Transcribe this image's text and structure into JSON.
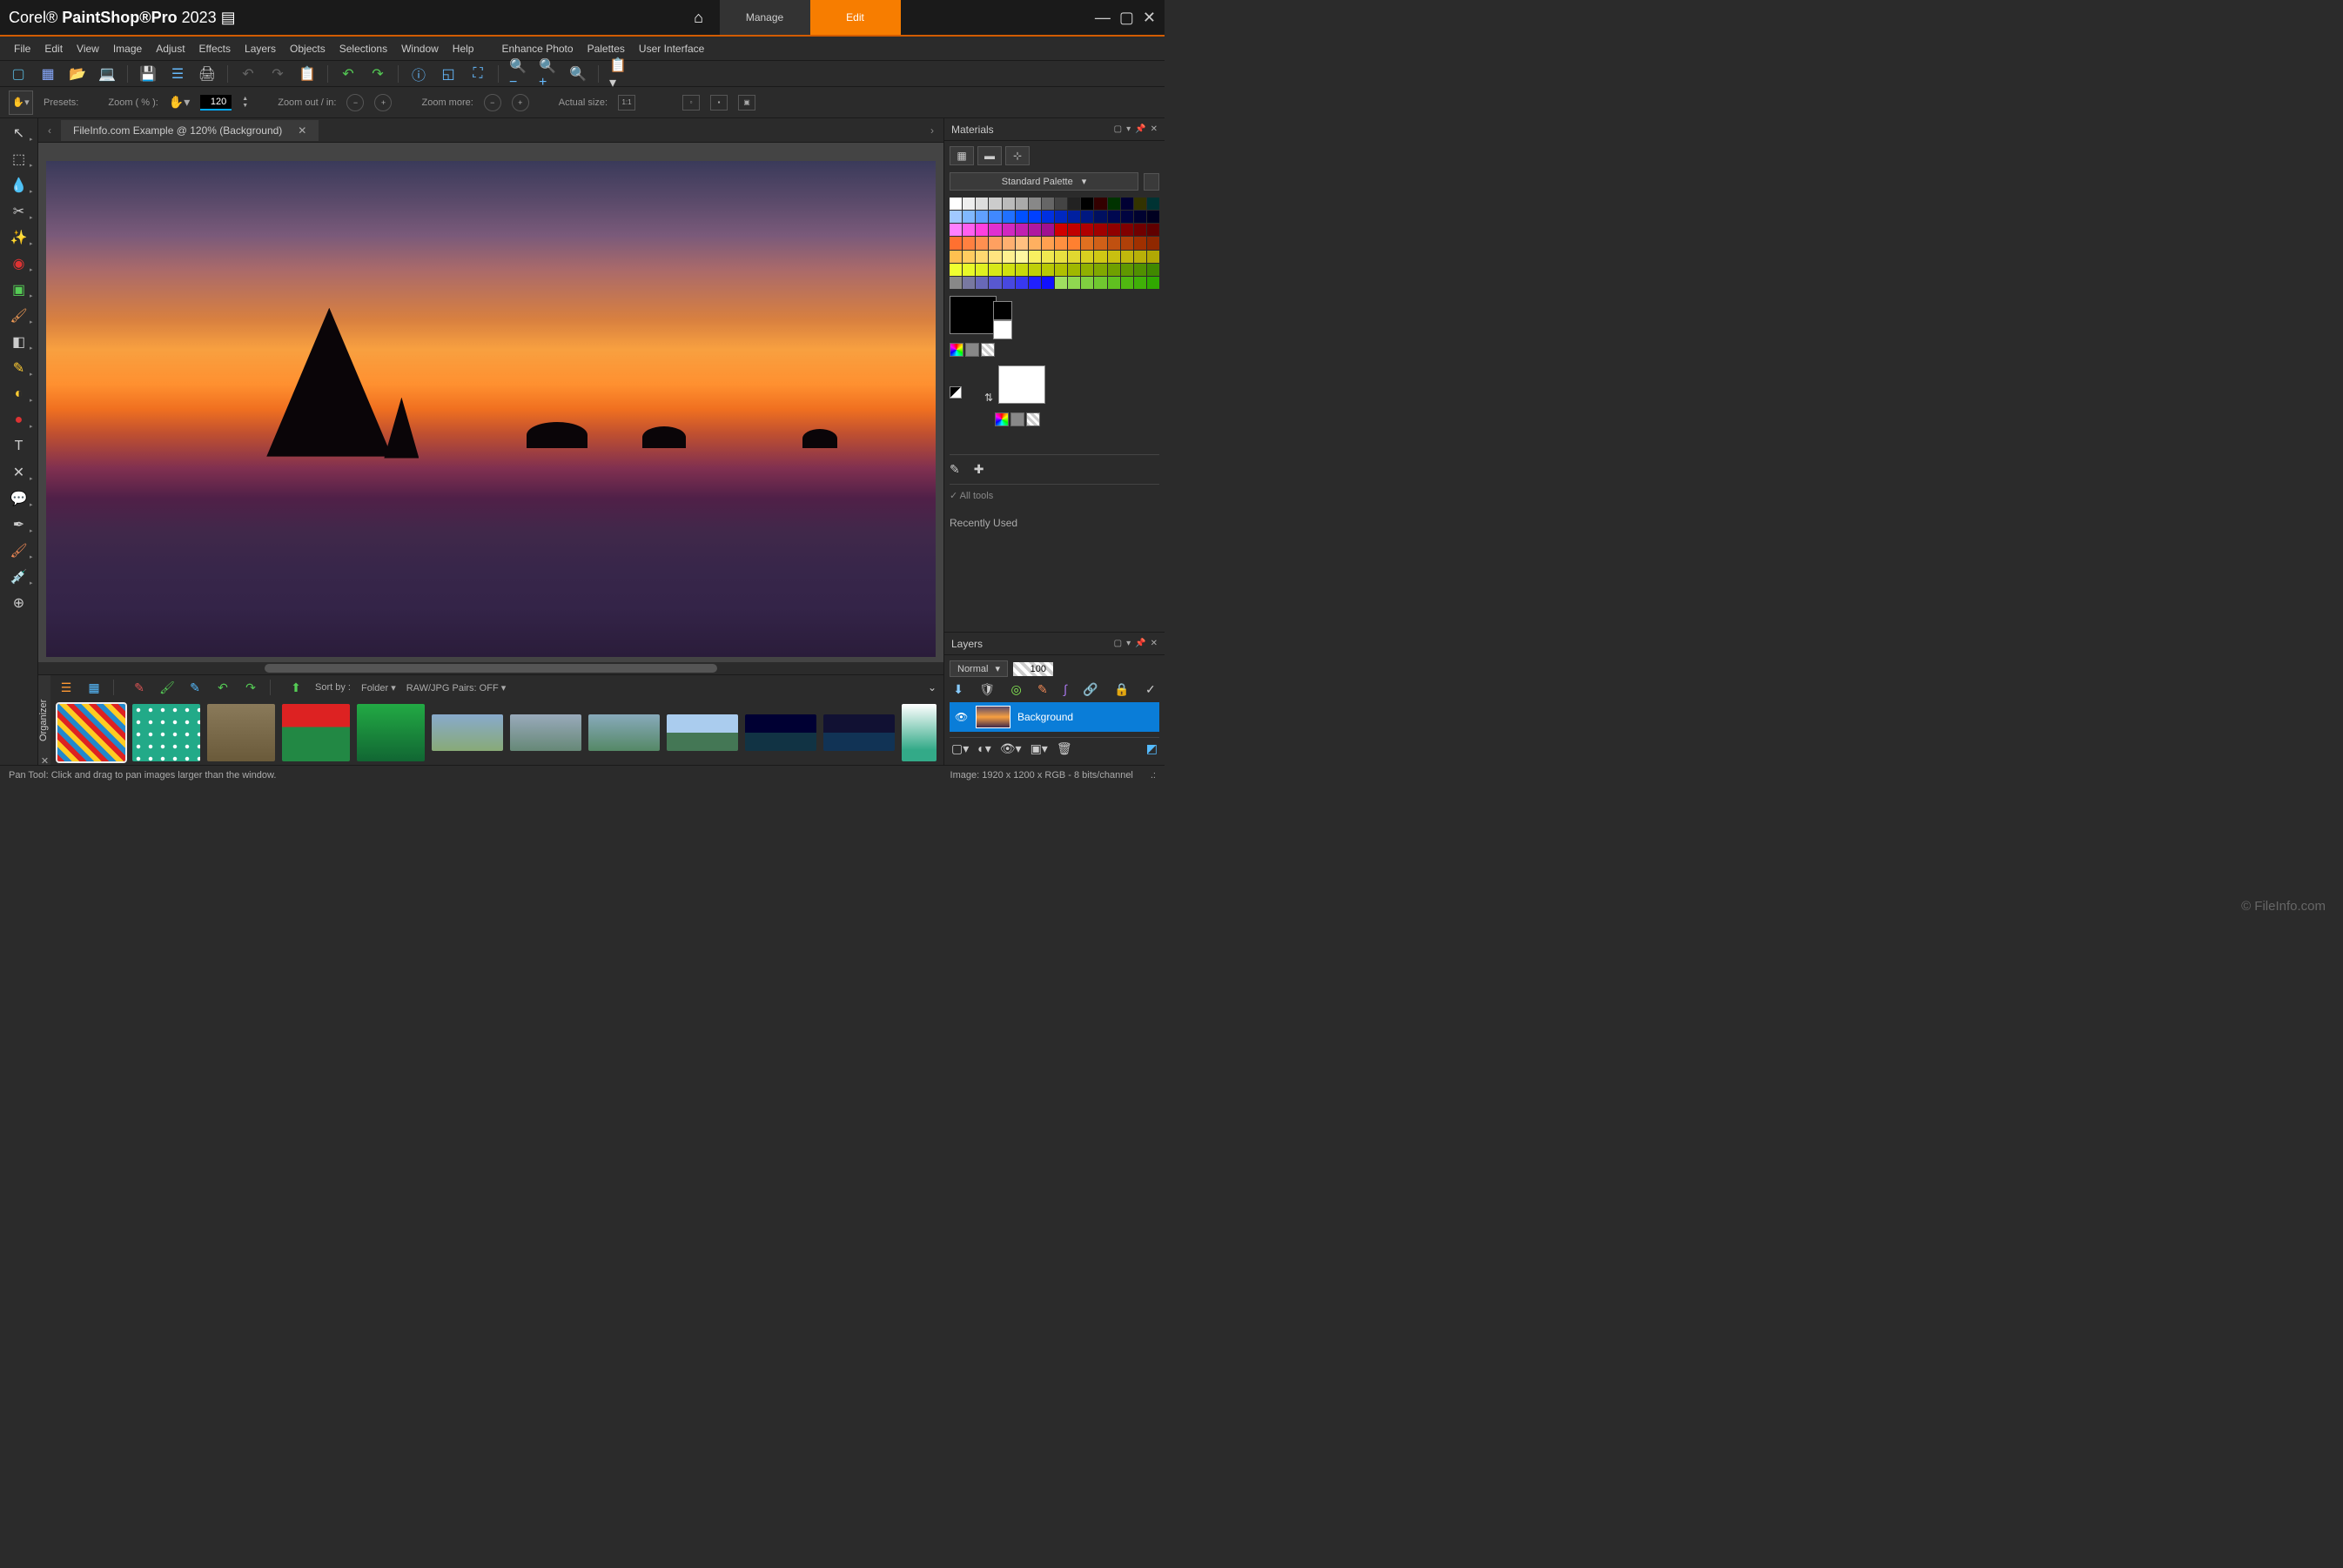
{
  "app": {
    "brand": "Corel®",
    "name": "PaintShop®",
    "suffix": "Pro",
    "year": "2023"
  },
  "topnav": {
    "manage": "Manage",
    "edit": "Edit"
  },
  "menu": [
    "File",
    "Edit",
    "View",
    "Image",
    "Adjust",
    "Effects",
    "Layers",
    "Objects",
    "Selections",
    "Window",
    "Help",
    "Enhance Photo",
    "Palettes",
    "User Interface"
  ],
  "tooloptions": {
    "presets": "Presets:",
    "zoom_pct": "Zoom ( % ):",
    "zoom_val": "120",
    "zoom_oi": "Zoom out / in:",
    "zoom_more": "Zoom more:",
    "actual": "Actual size:"
  },
  "doc_tab": "FileInfo.com Example @ 120% (Background)",
  "organizer": {
    "label": "Organizer",
    "sort": "Sort by :",
    "folder": "Folder ▾",
    "raw": "RAW/JPG Pairs: OFF ▾"
  },
  "materials": {
    "title": "Materials",
    "palette": "Standard Palette",
    "alltools": "All tools",
    "recent": "Recently Used",
    "watermark": "© FileInfo.com"
  },
  "layers": {
    "title": "Layers",
    "blend": "Normal",
    "opacity": "100",
    "bg": "Background"
  },
  "status": {
    "left": "Pan Tool: Click and drag to pan images larger than the window.",
    "right": "Image:   1920 x 1200 x RGB - 8 bits/channel"
  },
  "swatch_colors": [
    "#ffffff",
    "#eeeeee",
    "#dddddd",
    "#cccccc",
    "#bbbbbb",
    "#aaaaaa",
    "#888888",
    "#666666",
    "#444444",
    "#222222",
    "#000000",
    "#330000",
    "#003300",
    "#000033",
    "#333300",
    "#003333",
    "#a0c8ff",
    "#80b8ff",
    "#60a0ff",
    "#4088ff",
    "#2070ff",
    "#0050ff",
    "#0040ff",
    "#0030e0",
    "#0028c0",
    "#0020a0",
    "#001880",
    "#001060",
    "#000850",
    "#000440",
    "#000230",
    "#000020",
    "#ff80ff",
    "#ff60f0",
    "#ff40e0",
    "#e030d0",
    "#d028c0",
    "#c020b0",
    "#b018a0",
    "#a01090",
    "#d00000",
    "#c00000",
    "#b00000",
    "#a00000",
    "#900000",
    "#800000",
    "#700000",
    "#600000",
    "#ff7030",
    "#ff8040",
    "#ff9050",
    "#ffa060",
    "#ffb070",
    "#ffc080",
    "#ffb060",
    "#ffa050",
    "#ff9040",
    "#ff8030",
    "#e07020",
    "#d06018",
    "#c05010",
    "#b04008",
    "#a03000",
    "#902800",
    "#ffc050",
    "#ffcc60",
    "#ffd870",
    "#ffe480",
    "#fff090",
    "#fff8a0",
    "#f8f060",
    "#f0e850",
    "#e8e040",
    "#e0d830",
    "#d8d020",
    "#d0c814",
    "#c8c010",
    "#c0b80c",
    "#b8b008",
    "#b0a804",
    "#f0ff30",
    "#e8f828",
    "#e0f020",
    "#d8e818",
    "#d0e010",
    "#c8d80c",
    "#c0d008",
    "#b8c804",
    "#b0c000",
    "#a0b800",
    "#90b000",
    "#80a800",
    "#70a000",
    "#609800",
    "#509000",
    "#408800",
    "#888888",
    "#7878a0",
    "#6868b8",
    "#5858d0",
    "#4848e0",
    "#3838f0",
    "#2020ff",
    "#1010ff",
    "#a0e060",
    "#90d850",
    "#80d040",
    "#70c830",
    "#60c020",
    "#50b810",
    "#40b008",
    "#30a800"
  ]
}
